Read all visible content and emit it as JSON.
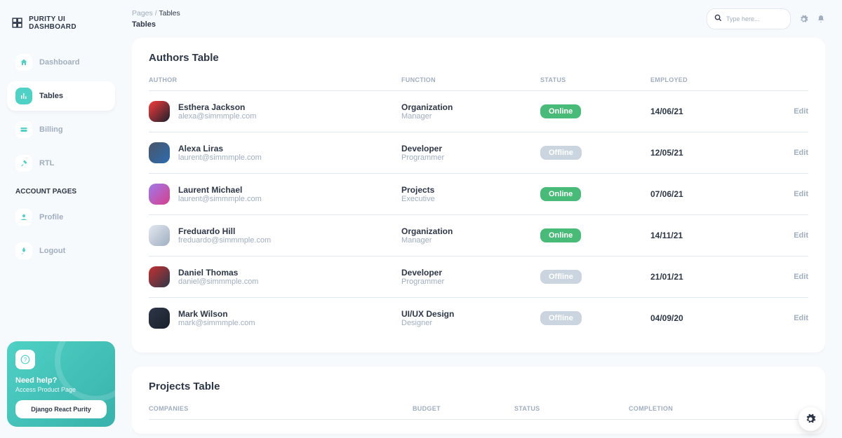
{
  "brand": {
    "name": "PURITY UI DASHBOARD"
  },
  "sidebar": {
    "items": [
      {
        "label": "Dashboard"
      },
      {
        "label": "Tables"
      },
      {
        "label": "Billing"
      },
      {
        "label": "RTL"
      }
    ],
    "section_title": "ACCOUNT PAGES",
    "account_items": [
      {
        "label": "Profile"
      },
      {
        "label": "Logout"
      }
    ],
    "help": {
      "title": "Need help?",
      "subtitle": "Access Product Page",
      "button": "Django React Purity"
    }
  },
  "header": {
    "breadcrumb_root": "Pages",
    "breadcrumb_current": "Tables",
    "page_title": "Tables",
    "search_placeholder": "Type here..."
  },
  "authors_table": {
    "title": "Authors Table",
    "columns": {
      "author": "AUTHOR",
      "function": "FUNCTION",
      "status": "STATUS",
      "employed": "EMPLOYED"
    },
    "rows": [
      {
        "name": "Esthera Jackson",
        "email": "alexa@simmmple.com",
        "func": "Organization",
        "sub": "Manager",
        "status": "Online",
        "date": "14/06/21"
      },
      {
        "name": "Alexa Liras",
        "email": "laurent@simmmple.com",
        "func": "Developer",
        "sub": "Programmer",
        "status": "Offline",
        "date": "12/05/21"
      },
      {
        "name": "Laurent Michael",
        "email": "laurent@simmmple.com",
        "func": "Projects",
        "sub": "Executive",
        "status": "Online",
        "date": "07/06/21"
      },
      {
        "name": "Freduardo Hill",
        "email": "freduardo@simmmple.com",
        "func": "Organization",
        "sub": "Manager",
        "status": "Online",
        "date": "14/11/21"
      },
      {
        "name": "Daniel Thomas",
        "email": "daniel@simmmple.com",
        "func": "Developer",
        "sub": "Programmer",
        "status": "Offline",
        "date": "21/01/21"
      },
      {
        "name": "Mark Wilson",
        "email": "mark@simmmple.com",
        "func": "UI/UX Design",
        "sub": "Designer",
        "status": "Offline",
        "date": "04/09/20"
      }
    ],
    "edit_label": "Edit"
  },
  "projects_table": {
    "title": "Projects Table",
    "columns": {
      "companies": "COMPANIES",
      "budget": "BUDGET",
      "status": "STATUS",
      "completion": "COMPLETION"
    }
  }
}
